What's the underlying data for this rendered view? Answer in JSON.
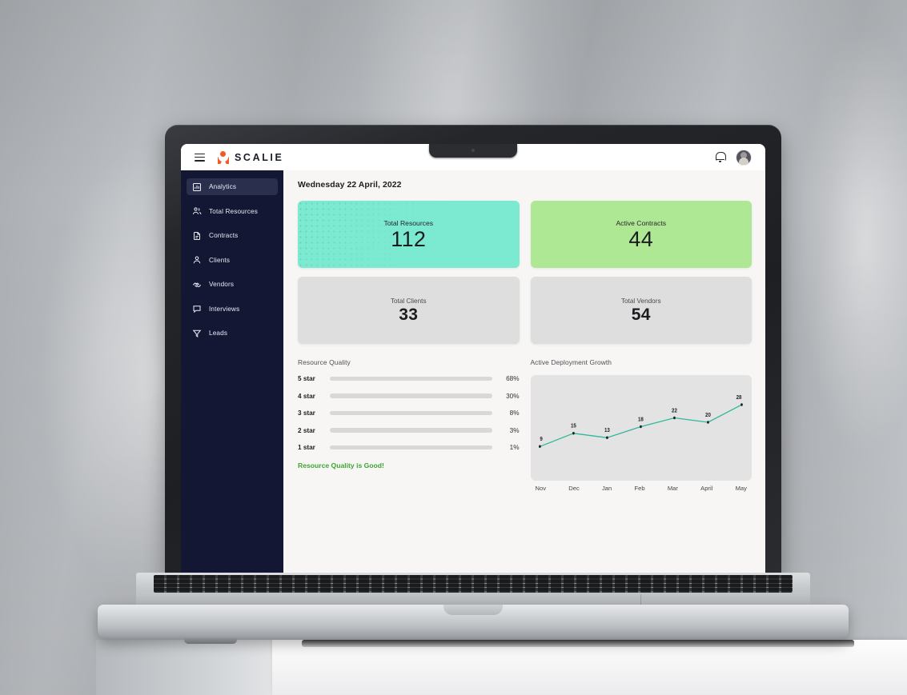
{
  "app": {
    "brand": "SCALIE",
    "menu_icon": "hamburger-icon",
    "bell_icon": "bell-icon",
    "avatar_icon": "user-avatar"
  },
  "sidebar": {
    "items": [
      {
        "label": "Analytics",
        "icon": "bar-chart-icon",
        "active": true
      },
      {
        "label": "Total Resources",
        "icon": "users-icon",
        "active": false
      },
      {
        "label": "Contracts",
        "icon": "document-icon",
        "active": false
      },
      {
        "label": "Clients",
        "icon": "user-icon",
        "active": false
      },
      {
        "label": "Vendors",
        "icon": "handshake-icon",
        "active": false
      },
      {
        "label": "Interviews",
        "icon": "chat-icon",
        "active": false
      },
      {
        "label": "Leads",
        "icon": "funnel-icon",
        "active": false
      }
    ]
  },
  "main": {
    "date": "Wednesday 22 April, 2022",
    "stats": [
      {
        "label": "Total Resources",
        "value": "112",
        "color": "#7ce9d1",
        "style": "teal"
      },
      {
        "label": "Active Contracts",
        "value": "44",
        "color": "#aee894",
        "style": "green"
      },
      {
        "label": "Total Clients",
        "value": "33",
        "color": "#dedede",
        "style": "muted"
      },
      {
        "label": "Total Vendors",
        "value": "54",
        "color": "#dedede",
        "style": "muted"
      }
    ],
    "quality": {
      "title": "Resource Quality",
      "rows": [
        {
          "label": "5 star",
          "pct": "68%",
          "value": 68
        },
        {
          "label": "4 star",
          "pct": "30%",
          "value": 30
        },
        {
          "label": "3 star",
          "pct": "8%",
          "value": 8
        },
        {
          "label": "2 star",
          "pct": "3%",
          "value": 3
        },
        {
          "label": "1 star",
          "pct": "1%",
          "value": 1
        }
      ],
      "note": "Resource Quality is Good!",
      "bar_color": "#e4622a",
      "note_color": "#3aa531"
    },
    "growth": {
      "title": "Active Deployment Growth"
    }
  },
  "chart_data": {
    "type": "line",
    "title": "Active Deployment Growth",
    "x": [
      "Nov",
      "Dec",
      "Jan",
      "Feb",
      "Mar",
      "April",
      "May"
    ],
    "values": [
      9,
      15,
      13,
      18,
      22,
      20,
      28
    ],
    "labels": [
      "9",
      "15",
      "13",
      "18",
      "22",
      "20",
      "28"
    ],
    "xlabel": "",
    "ylabel": "",
    "ylim": [
      0,
      32
    ],
    "grid": false,
    "legend": false,
    "line_color": "#2fb89a",
    "marker_color": "#1d1f22"
  }
}
